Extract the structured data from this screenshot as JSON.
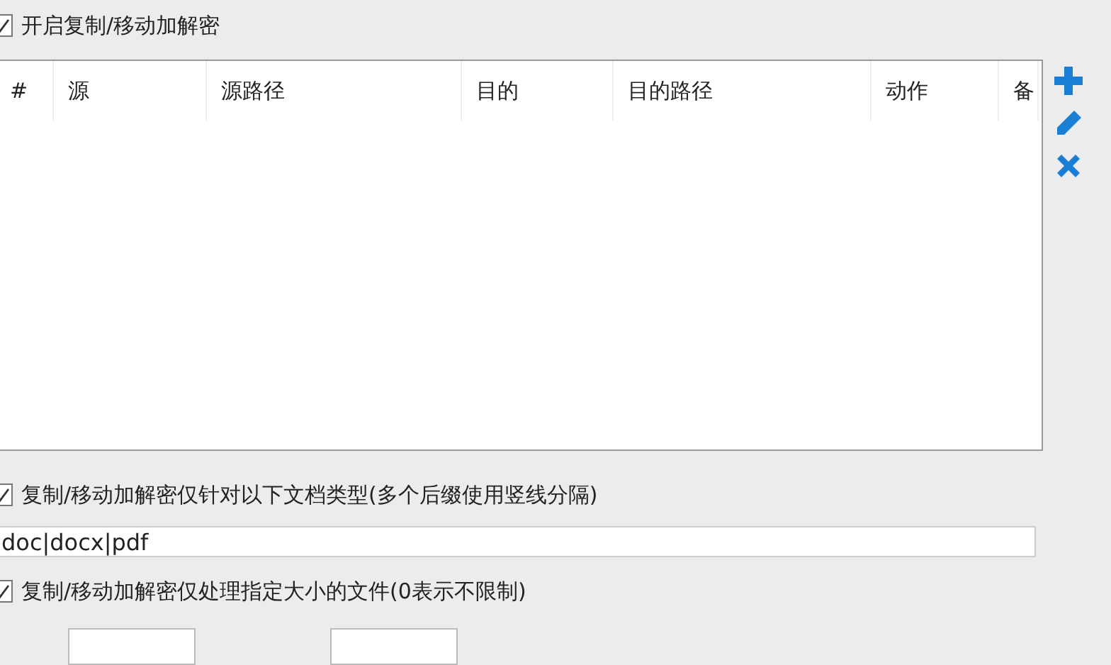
{
  "encrypt_toggle": {
    "label": "开启复制/移动加解密",
    "checked": true
  },
  "rules_table": {
    "columns": [
      "#",
      "源",
      "源路径",
      "目的",
      "目的路径",
      "动作",
      "备"
    ]
  },
  "side_tools": [
    {
      "kind": "add"
    },
    {
      "kind": "edit"
    },
    {
      "kind": "delete"
    }
  ],
  "type_filter": {
    "label": "复制/移动加解密仅针对以下文档类型(多个后缀使用竖线分隔)",
    "checked": true,
    "value": "doc|docx|pdf"
  },
  "size_filter": {
    "label": "复制/移动加解密仅处理指定大小的文件(0表示不限制)",
    "checked": true
  },
  "size_fields": [
    {
      "kind": "field"
    },
    {
      "kind": "field"
    }
  ]
}
